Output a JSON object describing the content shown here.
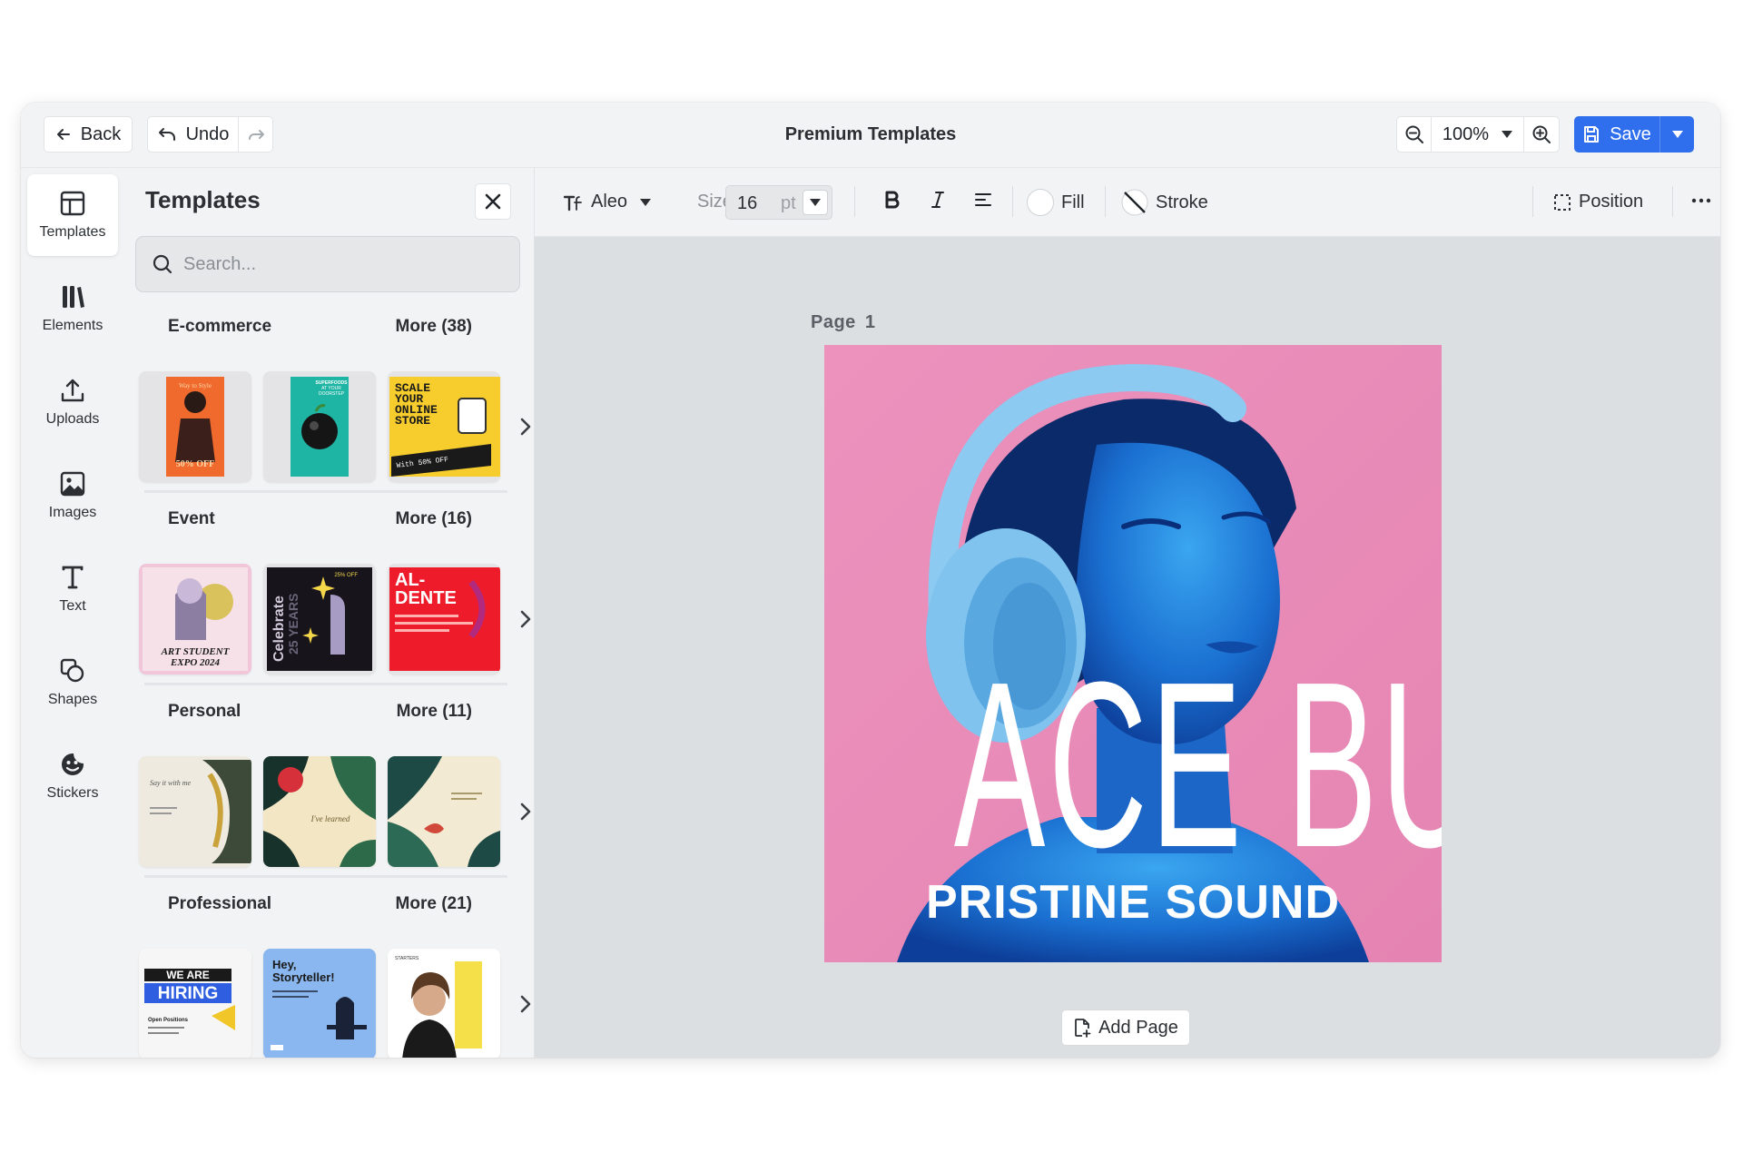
{
  "header": {
    "back_label": "Back",
    "undo_label": "Undo",
    "title": "Premium Templates",
    "zoom_value": "100%",
    "save_label": "Save"
  },
  "leftnav": {
    "items": [
      {
        "label": "Templates",
        "icon": "layout-icon"
      },
      {
        "label": "Elements",
        "icon": "elements-icon"
      },
      {
        "label": "Uploads",
        "icon": "upload-icon"
      },
      {
        "label": "Images",
        "icon": "image-icon"
      },
      {
        "label": "Text",
        "icon": "text-icon"
      },
      {
        "label": "Shapes",
        "icon": "shapes-icon"
      },
      {
        "label": "Stickers",
        "icon": "sticker-icon"
      }
    ],
    "active": "Templates"
  },
  "panel": {
    "title": "Templates",
    "search_placeholder": "Search...",
    "categories": [
      {
        "name": "E-commerce",
        "more": "More (38)",
        "thumbs": [
          {
            "alt": "fashion sale poster",
            "text": "50% OFF"
          },
          {
            "alt": "superfoods delivery poster",
            "text": "SUPERFOODS AT YOUR DOORSTEP IN TEN MINUTES"
          },
          {
            "alt": "scale your online store poster",
            "text": "SCALE YOUR ONLINE STORE",
            "text2": ">>> With 50% OFF your next order!"
          }
        ]
      },
      {
        "name": "Event",
        "more": "More (16)",
        "thumbs": [
          {
            "alt": "art student expo poster",
            "text": "ART STUDENT EXPO 2024"
          },
          {
            "alt": "celebrate 25 years poster",
            "text": "Celebrate 25 YEARS",
            "text2": "25% OFF"
          },
          {
            "alt": "al-dente poster",
            "text": "AL-DENTE"
          }
        ]
      },
      {
        "name": "Personal",
        "more": "More (11)",
        "thumbs": [
          {
            "alt": "say it with me card",
            "text": "Say it with me"
          },
          {
            "alt": "floral greeting card",
            "text": "I've learned"
          },
          {
            "alt": "koi fish card",
            "text": ""
          }
        ]
      },
      {
        "name": "Professional",
        "more": "More (21)",
        "thumbs": [
          {
            "alt": "we are hiring poster",
            "text": "WE ARE",
            "text2": "HIRING",
            "text3": "Open Positions"
          },
          {
            "alt": "hey storyteller poster",
            "text": "Hey, Storyteller!"
          },
          {
            "alt": "portrait profile poster",
            "text": "STARTERS"
          }
        ]
      }
    ]
  },
  "toolbar": {
    "font": "Aleo",
    "size_label": "Size",
    "size_value": "16",
    "size_unit": "pt",
    "fill_label": "Fill",
    "stroke_label": "Stroke",
    "position_label": "Position"
  },
  "canvas": {
    "page_word": "Page",
    "page_number": "1",
    "headline": "ACE BUDS",
    "subline": "PRISTINE SOUND",
    "add_page_label": "Add Page",
    "colors": {
      "background": "#e98fba",
      "skin": "#1c7fd6",
      "headphones": "#7fc3ee"
    }
  }
}
